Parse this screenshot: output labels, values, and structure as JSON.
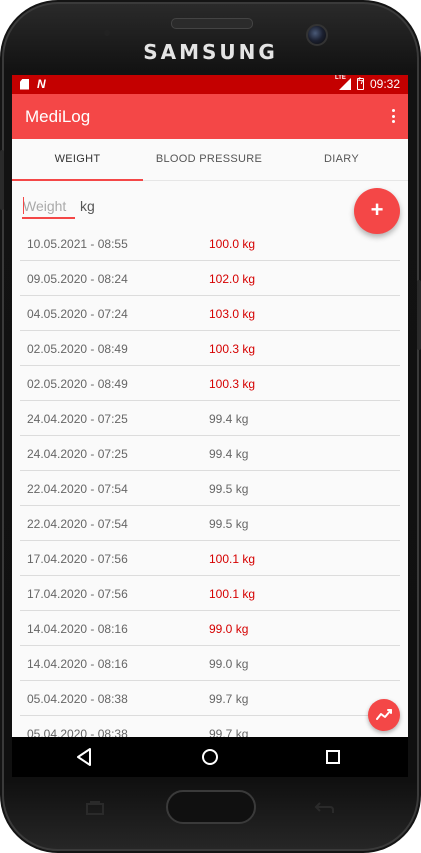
{
  "device": {
    "brand": "SAMSUNG"
  },
  "status_bar": {
    "time": "09:32",
    "network": "LTE"
  },
  "app": {
    "title": "MediLog"
  },
  "tabs": [
    {
      "label": "WEIGHT",
      "active": true
    },
    {
      "label": "BLOOD PRESSURE",
      "active": false
    },
    {
      "label": "DIARY",
      "active": false
    }
  ],
  "weight_input": {
    "placeholder": "Weight",
    "unit": "kg"
  },
  "entries": [
    {
      "date": "10.05.2021 - 08:55",
      "value": "100.0 kg",
      "high": true
    },
    {
      "date": "09.05.2020 - 08:24",
      "value": "102.0 kg",
      "high": true
    },
    {
      "date": "04.05.2020 - 07:24",
      "value": "103.0 kg",
      "high": true
    },
    {
      "date": "02.05.2020 - 08:49",
      "value": "100.3 kg",
      "high": true
    },
    {
      "date": "02.05.2020 - 08:49",
      "value": "100.3 kg",
      "high": true
    },
    {
      "date": "24.04.2020 - 07:25",
      "value": "99.4 kg",
      "high": false
    },
    {
      "date": "24.04.2020 - 07:25",
      "value": "99.4 kg",
      "high": false
    },
    {
      "date": "22.04.2020 - 07:54",
      "value": "99.5 kg",
      "high": false
    },
    {
      "date": "22.04.2020 - 07:54",
      "value": "99.5 kg",
      "high": false
    },
    {
      "date": "17.04.2020 - 07:56",
      "value": "100.1 kg",
      "high": true
    },
    {
      "date": "17.04.2020 - 07:56",
      "value": "100.1 kg",
      "high": true
    },
    {
      "date": "14.04.2020 - 08:16",
      "value": "99.0 kg",
      "high": true
    },
    {
      "date": "14.04.2020 - 08:16",
      "value": "99.0 kg",
      "high": false
    },
    {
      "date": "05.04.2020 - 08:38",
      "value": "99.7 kg",
      "high": false
    },
    {
      "date": "05.04.2020 - 08:38",
      "value": "99.7 kg",
      "high": false
    }
  ],
  "colors": {
    "accent": "#f44747",
    "status_bar": "#c40000",
    "high_value": "#d50000"
  },
  "icons": {
    "add": "plus-icon",
    "chart": "trend-chart-icon",
    "menu": "overflow-menu-icon",
    "nav_back": "back-triangle-icon",
    "nav_home": "home-circle-icon",
    "nav_recent": "recent-square-icon"
  }
}
